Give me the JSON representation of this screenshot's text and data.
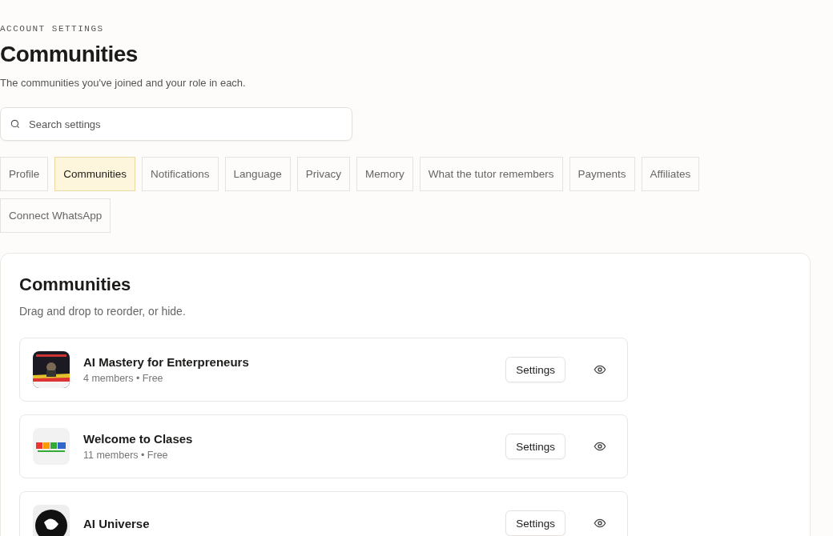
{
  "header": {
    "eyebrow": "ACCOUNT SETTINGS",
    "title": "Communities",
    "subtitle": "The communities you've joined and your role in each."
  },
  "search": {
    "placeholder": "Search settings"
  },
  "tabs": [
    {
      "label": "Profile",
      "selected": false
    },
    {
      "label": "Communities",
      "selected": true
    },
    {
      "label": "Notifications",
      "selected": false
    },
    {
      "label": "Language",
      "selected": false
    },
    {
      "label": "Privacy",
      "selected": false
    },
    {
      "label": "Memory",
      "selected": false
    },
    {
      "label": "What the tutor remembers",
      "selected": false
    },
    {
      "label": "Payments",
      "selected": false
    },
    {
      "label": "Affiliates",
      "selected": false
    },
    {
      "label": "Connect WhatsApp",
      "selected": false
    }
  ],
  "panel": {
    "title": "Communities",
    "subtitle": "Drag and drop to reorder, or hide.",
    "communities": [
      {
        "name": "AI Mastery for Enterpreneurs",
        "meta": "4 members • Free",
        "button": "Settings"
      },
      {
        "name": "Welcome to Clases",
        "meta": "11 members • Free",
        "button": "Settings"
      },
      {
        "name": "AI Universe",
        "button": "Settings"
      }
    ]
  }
}
